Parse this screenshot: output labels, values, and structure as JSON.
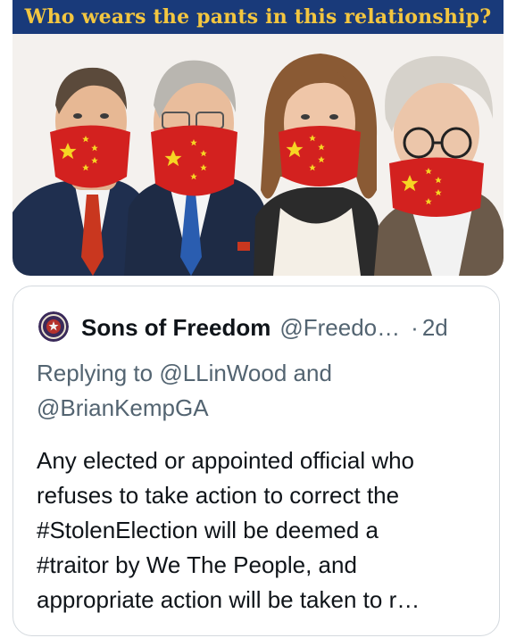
{
  "image": {
    "banner_text": "Who wears the pants in this relationship?",
    "colors": {
      "banner_bg": "#193a7a",
      "banner_text": "#f3c640",
      "mask_red": "#d3211f",
      "mask_star": "#f6d523"
    }
  },
  "tweet": {
    "display_name": "Sons of Freedom",
    "handle": "@Freedo…",
    "separator": "·",
    "timestamp": "2d",
    "replying_prefix": "Replying to ",
    "reply_mention_1": "@LLinWood",
    "reply_and": " and",
    "reply_mention_2": "@BrianKempGA",
    "text_lines": [
      "Any elected or appointed official who",
      "refuses to take action to correct the",
      "#StolenElection will be deemed a",
      "#traitor by We The People, and",
      "appropriate action will be taken to r…"
    ],
    "avatar_icon": "sons-of-freedom-seal-icon"
  }
}
